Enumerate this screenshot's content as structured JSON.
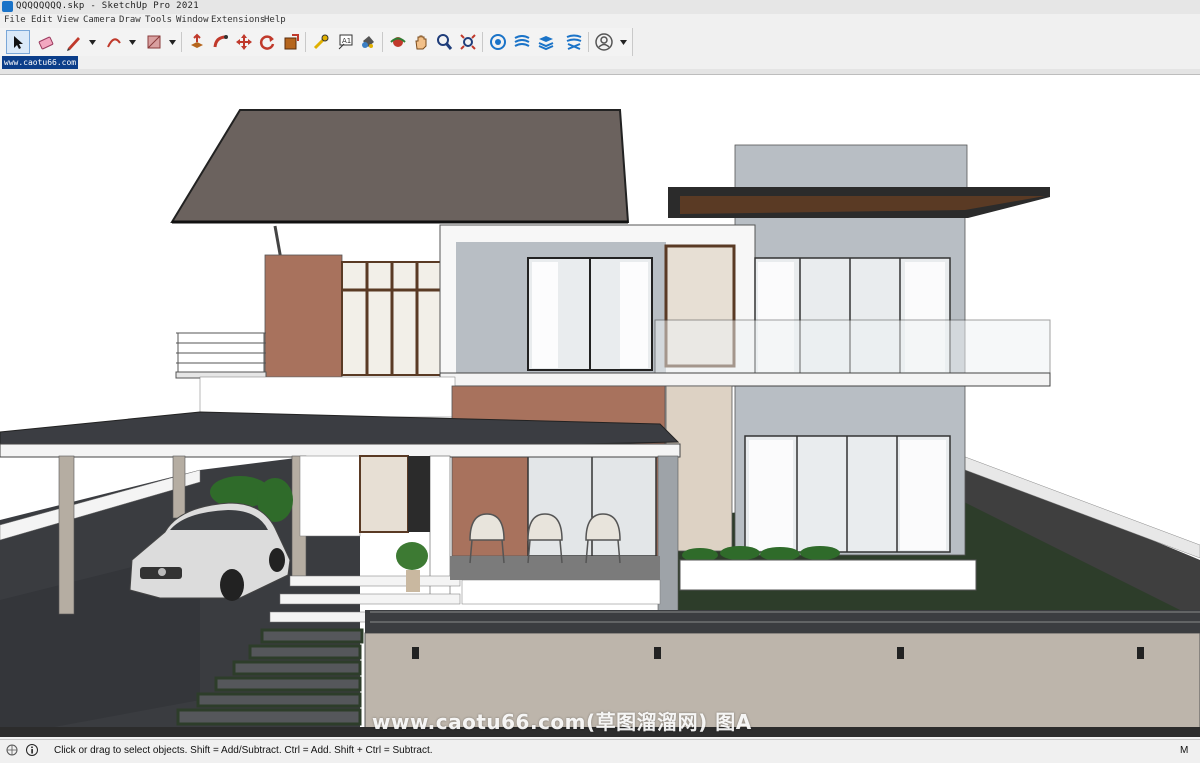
{
  "window": {
    "title": "QQQQQQQQ.skp - SketchUp Pro 2021"
  },
  "menu": [
    "File",
    "Edit",
    "View",
    "Camera",
    "Draw",
    "Tools",
    "Window",
    "Extensions",
    "Help"
  ],
  "toolbar": {
    "tools": [
      {
        "name": "select-tool",
        "icon": "arrow-cursor-icon"
      },
      {
        "name": "eraser-tool",
        "icon": "eraser-icon"
      },
      {
        "name": "line-tool",
        "icon": "pencil-icon"
      },
      {
        "name": "arc-tool",
        "icon": "arc-icon"
      },
      {
        "name": "shapes-tool",
        "icon": "rectangle-icon"
      },
      {
        "name": "push-pull-tool",
        "icon": "push-pull-icon"
      },
      {
        "name": "follow-me-tool",
        "icon": "follow-me-icon"
      },
      {
        "name": "move-tool",
        "icon": "move-icon"
      },
      {
        "name": "rotate-tool",
        "icon": "rotate-icon"
      },
      {
        "name": "scale-tool",
        "icon": "scale-icon"
      },
      {
        "name": "tape-measure-tool",
        "icon": "tape-measure-icon"
      },
      {
        "name": "text-tool",
        "icon": "text-icon"
      },
      {
        "name": "paint-bucket-tool",
        "icon": "paint-bucket-icon"
      },
      {
        "name": "orbit-tool",
        "icon": "orbit-icon"
      },
      {
        "name": "pan-tool",
        "icon": "pan-hand-icon"
      },
      {
        "name": "zoom-tool",
        "icon": "zoom-icon"
      },
      {
        "name": "zoom-extents-tool",
        "icon": "zoom-extents-icon"
      },
      {
        "name": "3d-warehouse-button",
        "icon": "warehouse-icon"
      },
      {
        "name": "extension-warehouse-button",
        "icon": "extension-icon"
      },
      {
        "name": "layout-button",
        "icon": "layout-icon"
      },
      {
        "name": "extension-manager-button",
        "icon": "extension-manager-icon"
      },
      {
        "name": "account-button",
        "icon": "user-icon"
      }
    ]
  },
  "scene_tab": {
    "label": "www.caotu66.com"
  },
  "status": {
    "message": "Click or drag to select objects. Shift = Add/Subtract. Ctrl = Add. Shift + Ctrl = Subtract.",
    "measurements_label": "M"
  },
  "watermark": {
    "text": "www.caotu66.com(草图溜溜网) 图A"
  },
  "colors": {
    "brand_blue": "#1a73c8",
    "roof": "#6b625e",
    "brick": "#a8725d",
    "wall_grey": "#b8bec4",
    "lawn": "#2d3d2a",
    "driveway": "#3a3c40"
  }
}
